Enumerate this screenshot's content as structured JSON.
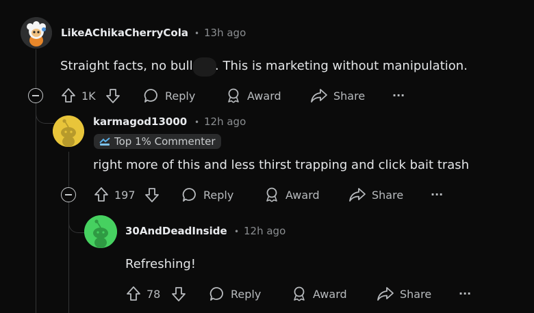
{
  "comments": [
    {
      "username": "LikeAChikaCherryCola",
      "time": "13h ago",
      "text": "Straight facts, no bull",
      "text_after": ". This is marketing without manipulation.",
      "votes": "1K",
      "avatar_icon": "snoo-avatar-sheep-costume-icon"
    },
    {
      "username": "karmagod13000",
      "badge": "Top 1% Commenter",
      "text": "right more of this and less thirst trapping and click bait trash",
      "votes": "197",
      "avatar_color": "#e8c53a",
      "avatar_icon": "snoo-avatar-icon"
    },
    {
      "username": "30AndDeadInside",
      "time": "12h ago",
      "text": "Refreshing!",
      "votes": "78",
      "avatar_color": "#46d160",
      "avatar_icon": "snoo-avatar-icon"
    }
  ],
  "second_time": "12h ago",
  "actions": {
    "reply": "Reply",
    "award": "Award",
    "share": "Share",
    "more": "···"
  },
  "separator": "•"
}
